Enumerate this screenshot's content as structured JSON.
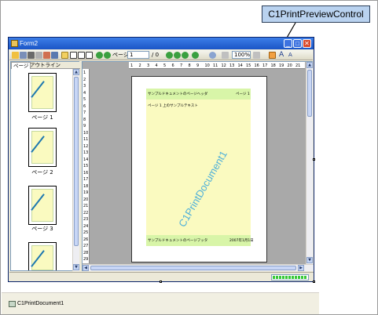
{
  "callout": {
    "label": "C1PrintPreviewControl"
  },
  "window": {
    "title": "Form2",
    "minimize_glyph": "_",
    "maximize_glyph": "□",
    "close_glyph": "✕"
  },
  "toolbar": {
    "page_label": "ページ",
    "page_value": "1",
    "page_total": "/ 0",
    "zoom_value": "100%",
    "font_large_glyph": "A",
    "font_small_glyph": "A"
  },
  "left_tabs": [
    {
      "label": "ページ"
    },
    {
      "label": "アウトライン"
    }
  ],
  "thumbnails": [
    {
      "label": "ページ 1"
    },
    {
      "label": "ページ 2"
    },
    {
      "label": "ページ 3"
    }
  ],
  "ruler": {
    "h_ticks": [
      "1",
      "2",
      "3",
      "4",
      "5",
      "6",
      "7",
      "8",
      "9",
      "10",
      "11",
      "12",
      "13",
      "14",
      "15",
      "16",
      "17",
      "18",
      "19",
      "20",
      "21"
    ],
    "v_ticks": [
      "1",
      "2",
      "3",
      "4",
      "5",
      "6",
      "7",
      "8",
      "9",
      "10",
      "11",
      "12",
      "13",
      "14",
      "15",
      "16",
      "17",
      "18",
      "19",
      "20",
      "21",
      "22",
      "23",
      "24",
      "25",
      "26",
      "27",
      "28",
      "29"
    ]
  },
  "page": {
    "header_left": "サンプルドキュメントのページヘッダ",
    "header_right": "ページ 1",
    "body_line": "ページ 1 上のサンプルテキスト",
    "watermark": "C1PrintDocument1",
    "footer_left": "サンプルドキュメントのページフッタ",
    "footer_right": "2007年1月1日"
  },
  "status": {
    "progress_blocks": 11
  },
  "tray": {
    "component_label": "C1PrintDocument1"
  },
  "colors": {
    "titlebar": "#1b55c6",
    "page_header_band": "#d8f5a8",
    "page_body": "#fafac0",
    "watermark_text": "#4fb0d9",
    "callout_fill": "#b9d2ef"
  }
}
